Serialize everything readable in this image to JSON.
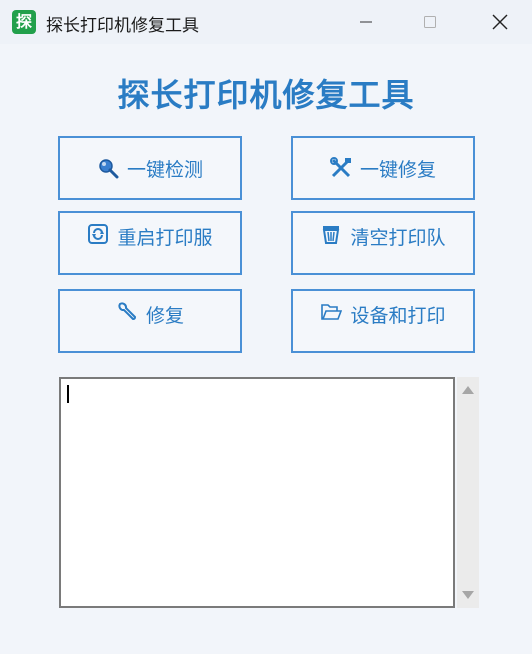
{
  "window": {
    "title": "探长打印机修复工具",
    "app_icon_char": "探"
  },
  "heading": "探长打印机修复工具",
  "buttons": [
    {
      "label": "一键检测",
      "icon": "search-icon"
    },
    {
      "label": "一键修复",
      "icon": "tools-icon"
    },
    {
      "label": "重启打印服",
      "icon": "refresh-icon"
    },
    {
      "label": "清空打印队",
      "icon": "trash-icon"
    },
    {
      "label": "修复",
      "icon": "wrench-icon"
    },
    {
      "label": "设备和打印",
      "icon": "folder-icon"
    }
  ],
  "output": {
    "value": ""
  },
  "colors": {
    "accent": "#2a7cc4",
    "border": "#4a90d6",
    "app_icon": "#22a04b"
  }
}
